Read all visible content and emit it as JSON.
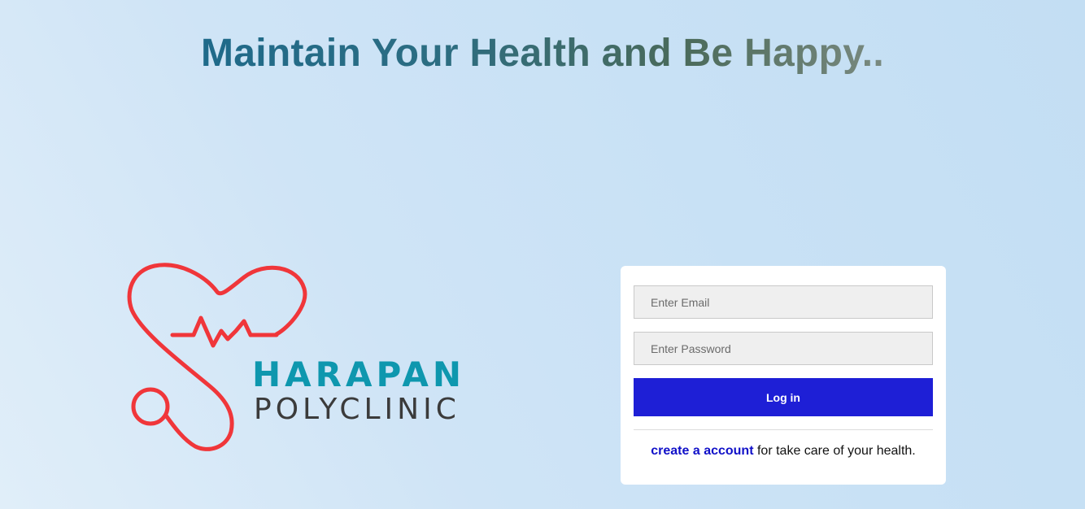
{
  "header": {
    "headline": "Maintain Your Health and Be Happy.."
  },
  "logo": {
    "icon": "heart-stethoscope-icon",
    "brand_line1": "HARAPAN",
    "brand_line2": "POLYCLINIC",
    "colors": {
      "heart": "#f0363a",
      "brand_primary": "#0e97ae",
      "brand_secondary": "#3b3b3b"
    }
  },
  "login": {
    "email_placeholder": "Enter Email",
    "email_value": "",
    "password_placeholder": "Enter Password",
    "password_value": "",
    "login_label": "Log in",
    "signup_link": "create a account",
    "signup_suffix": " for take care of your health."
  },
  "colors": {
    "button": "#1e1fd6",
    "link": "#1010c8"
  }
}
